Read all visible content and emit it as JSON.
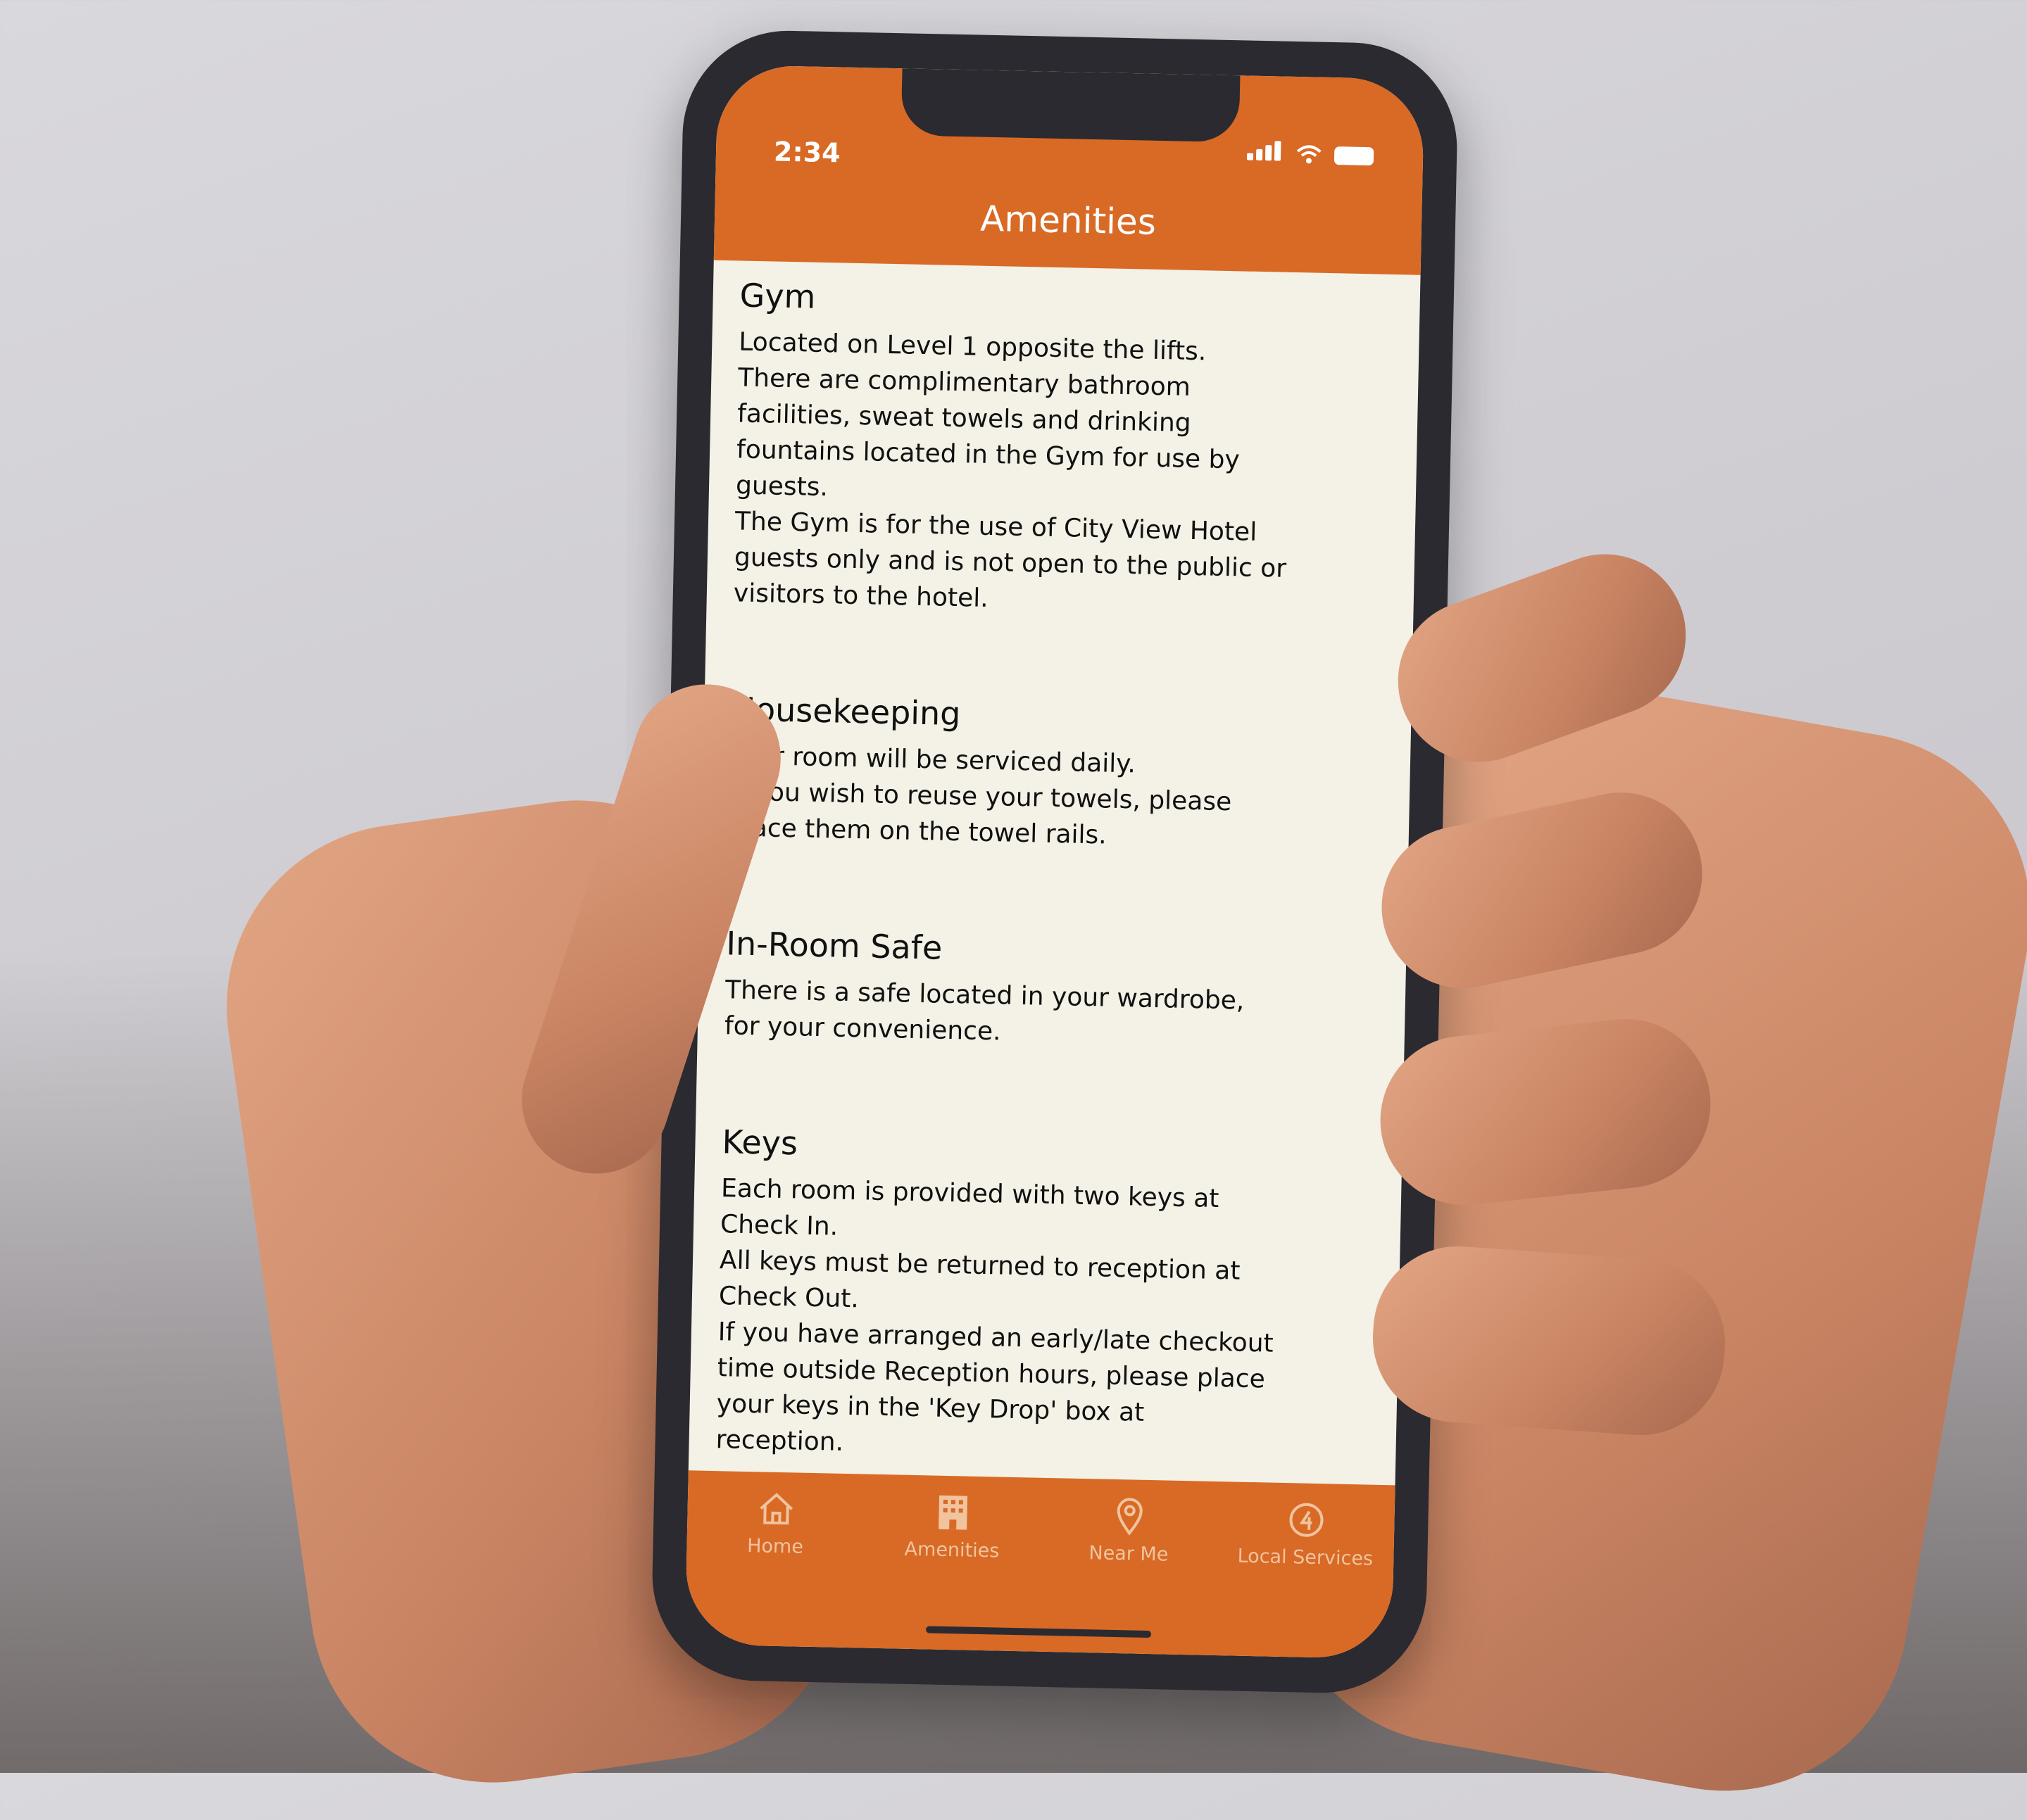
{
  "status_bar": {
    "time": "2:34"
  },
  "header": {
    "title": "Amenities"
  },
  "sections": [
    {
      "title": "Gym",
      "lines": [
        "Located on Level 1 opposite the lifts.",
        "There are complimentary bathroom",
        "facilities, sweat towels and drinking",
        "fountains located in the Gym for use by",
        "guests.",
        "The Gym is for the use of City View Hotel",
        "guests only and is not open to the public or",
        "visitors to the hotel."
      ]
    },
    {
      "title": "Housekeeping",
      "lines": [
        "Your room will be serviced daily.",
        "If you wish to reuse your towels, please",
        "place them on the towel rails."
      ]
    },
    {
      "title": "In-Room Safe",
      "lines": [
        "There is a safe located in your wardrobe,",
        "for your convenience."
      ]
    },
    {
      "title": "Keys",
      "lines": [
        "Each room is provided with two keys at",
        "Check In.",
        "All keys must be returned to reception at",
        "Check Out.",
        "If you have arranged an early/late checkout",
        "time outside Reception hours, please place",
        "your keys in the 'Key Drop' box at",
        "reception."
      ]
    }
  ],
  "tabs": [
    {
      "label": "Home",
      "icon": "home-icon"
    },
    {
      "label": "Amenities",
      "icon": "building-icon"
    },
    {
      "label": "Near Me",
      "icon": "location-pin-icon"
    },
    {
      "label": "Local Services",
      "icon": "services-icon"
    }
  ],
  "colors": {
    "accent": "#d86a25",
    "background": "#f4f1e6",
    "text": "#111111"
  }
}
